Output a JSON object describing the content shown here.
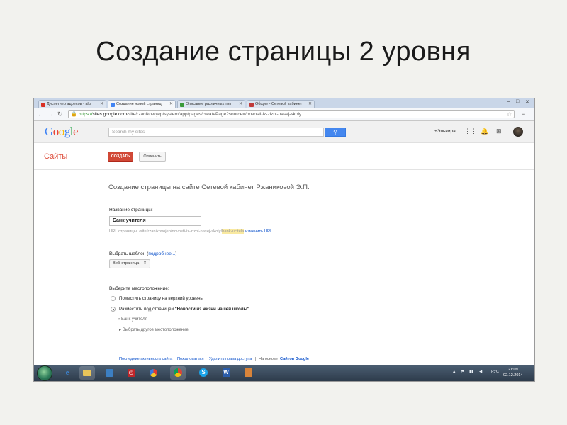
{
  "slide": {
    "title": "Создание страницы 2 уровня"
  },
  "browser": {
    "tabs": [
      {
        "label": "Диспетчер адресов - alu",
        "fav_color": "#d93025",
        "active": false
      },
      {
        "label": "Создание новой страниц",
        "fav_color": "#4285f4",
        "active": true
      },
      {
        "label": "Описание различных тип",
        "fav_color": "#3a9a3a",
        "active": false
      },
      {
        "label": "Общие - Сетевой кабинет",
        "fav_color": "#c03a3a",
        "active": false
      }
    ],
    "url_scheme": "https://",
    "url_host": "sites.google.com",
    "url_path": "/site/rzanikovojep/system/app/pages/createPage?source=/novosti-iz-zizni-nasej-skoly"
  },
  "google_header": {
    "logo": "Google",
    "logo_colors": [
      "#4285f4",
      "#ea4335",
      "#fbbc05",
      "#4285f4",
      "#34a853",
      "#ea4335"
    ],
    "search_placeholder": "Search my sites",
    "user_link": "+Эльвира"
  },
  "sites_bar": {
    "label": "Сайты",
    "create_button": "СОЗДАТЬ",
    "cancel_button": "Отменить"
  },
  "form": {
    "heading": "Создание страницы на сайте Сетевой кабинет Ржаниковой Э.П.",
    "page_name_label": "Название страницы:",
    "page_name_value": "Банк учителя",
    "url_prefix": "URL страницы: /site/rzanikovojep/novosti-iz-zizni-nasej-skoly/",
    "url_highlight": "bank-ucitela",
    "url_change_link": "изменить URL",
    "template_label": "Выбрать шаблон",
    "template_more_link": "подробнее...",
    "template_select": "Веб-страница",
    "location_label": "Выберите местоположение:",
    "option_top": "Поместить страницу на верхний уровень",
    "option_under_prefix": "Разместить под страницей ",
    "option_under_page": "\"Новости из жизни нашей школы\"",
    "sub_item": "» Банк учителя",
    "choose_other": "Выбрать другое местоположение"
  },
  "footer": {
    "recent_activity": "Последние активность сайта",
    "report_abuse": "Пожаловаться",
    "remove_access": "Удалить права доступа",
    "powered_by": "На основе",
    "google_sites": "Сайтов Google"
  },
  "taskbar": {
    "lang": "РУС",
    "time": "21:09",
    "date": "02.12.2014"
  }
}
